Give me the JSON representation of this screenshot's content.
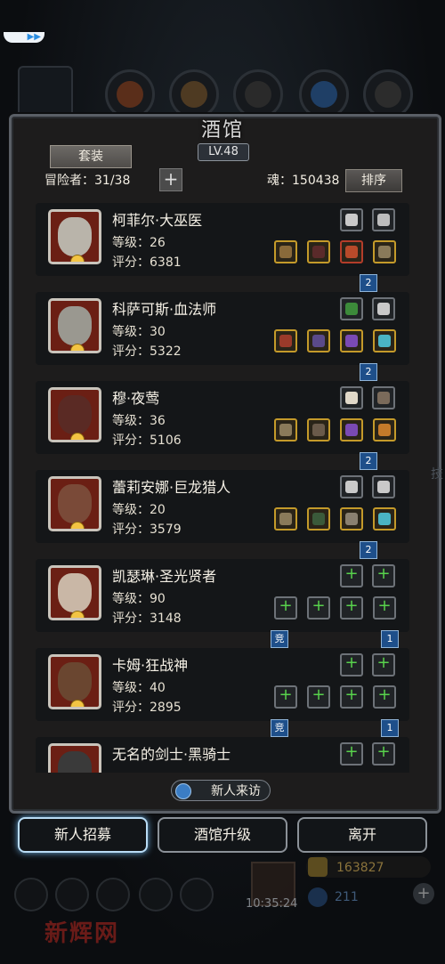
{
  "window": {
    "title": "酒馆",
    "level": "LV.48"
  },
  "header": {
    "suit_button": "套装",
    "adventurers": "冒险者：31/38",
    "soul": "魂：150438",
    "sort_button": "排序"
  },
  "heroes": [
    {
      "name": "柯菲尔·大巫医",
      "level": "等级：26",
      "score": "评分：6381",
      "badge": "2",
      "portrait_color": "#b9b4aa",
      "slots_top": [
        "sword",
        "spear"
      ],
      "slots_bottom": [
        "staff",
        "robe",
        "orb",
        "bow"
      ]
    },
    {
      "name": "科萨可斯·血法师",
      "level": "等级：30",
      "score": "评分：5322",
      "badge": "2",
      "portrait_color": "#9a9890",
      "slots_top": [
        "green-tome",
        "sword"
      ],
      "slots_bottom": [
        "red-staff",
        "gauntlet",
        "purple-ring",
        "blue-ring"
      ]
    },
    {
      "name": "穆·夜莺",
      "level": "等级：36",
      "score": "评分：5106",
      "badge": "2",
      "portrait_color": "#5a2a24",
      "slots_top": [
        "horn",
        "armor"
      ],
      "slots_bottom": [
        "bow",
        "chest",
        "purple-ring",
        "gold-ring"
      ]
    },
    {
      "name": "蕾莉安娜·巨龙猎人",
      "level": "等级：20",
      "score": "评分：3579",
      "badge": "2",
      "portrait_color": "#7a4a38",
      "slots_top": [
        "sword",
        "sword"
      ],
      "slots_bottom": [
        "bow",
        "green-armor",
        "helm",
        "blue-ring"
      ]
    },
    {
      "name": "凯瑟琳·圣光贤者",
      "level": "等级：90",
      "score": "评分：3148",
      "badge": "1",
      "compete": "竞",
      "portrait_color": "#c9b7a6",
      "slots_top": [
        "add",
        "add"
      ],
      "slots_bottom": [
        "add-weapon",
        "add-armor",
        "add",
        "add"
      ]
    },
    {
      "name": "卡姆·狂战神",
      "level": "等级：40",
      "score": "评分：2895",
      "badge": "1",
      "compete": "竞",
      "portrait_color": "#6a4630",
      "slots_top": [
        "add",
        "add"
      ],
      "slots_bottom": [
        "add-weapon",
        "add-armor",
        "add",
        "add"
      ]
    },
    {
      "name": "无名的剑士·黑骑士",
      "level": "",
      "score": "",
      "portrait_color": "#3a3a3a",
      "slots_top": [
        "add",
        "add"
      ],
      "slots_bottom": []
    }
  ],
  "newcomer": "新人来访",
  "bottom": {
    "recruit": "新人招募",
    "upgrade": "酒馆升级",
    "leave": "离开"
  },
  "dock": {
    "timer": "10:35:24",
    "gold": "163827",
    "gems": "211"
  },
  "watermark": "新辉网",
  "colors": {
    "accent_blue": "#6eaede",
    "gold_border": "#c49a2a",
    "badge_blue": "#1e4f8a",
    "plus_green": "#58d24c"
  }
}
